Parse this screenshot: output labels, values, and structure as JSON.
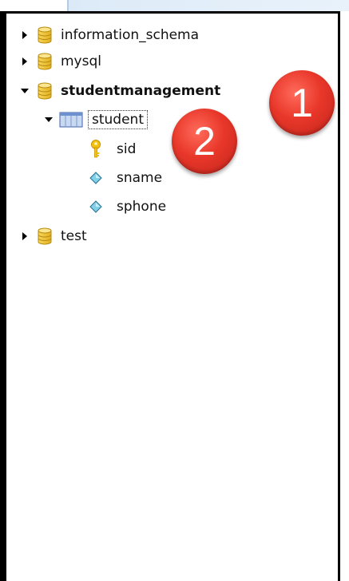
{
  "tree": {
    "databases": [
      {
        "name": "information_schema",
        "expanded": false,
        "icon": "database-icon"
      },
      {
        "name": "mysql",
        "expanded": false,
        "icon": "database-icon"
      },
      {
        "name": "studentmanagement",
        "expanded": true,
        "icon": "database-icon",
        "tables": [
          {
            "name": "student",
            "expanded": true,
            "icon": "table-icon",
            "columns": [
              {
                "name": "sid",
                "icon": "primary-key-icon"
              },
              {
                "name": "sname",
                "icon": "column-icon"
              },
              {
                "name": "sphone",
                "icon": "column-icon"
              }
            ]
          }
        ]
      },
      {
        "name": "test",
        "expanded": false,
        "icon": "database-icon"
      }
    ]
  },
  "annotations": [
    {
      "label": "1",
      "color": "#e53b2e"
    },
    {
      "label": "2",
      "color": "#e53b2e"
    }
  ]
}
